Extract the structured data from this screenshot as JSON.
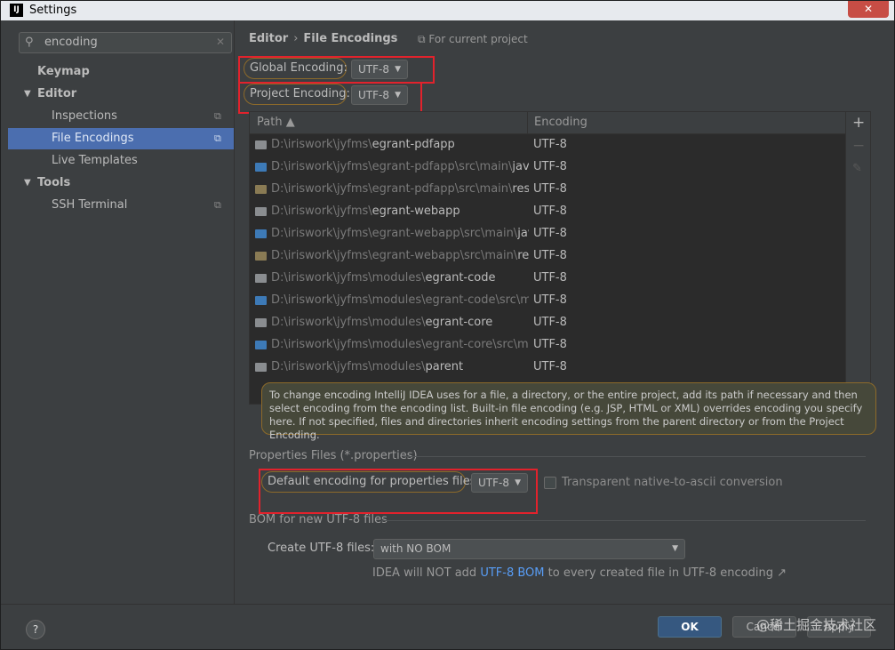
{
  "window": {
    "title": "Settings",
    "app_icon": "IJ",
    "close_glyph": "✕"
  },
  "sidebar": {
    "search_value": "encoding",
    "items": [
      {
        "label": "Keymap"
      },
      {
        "label": "Editor"
      },
      {
        "label": "Inspections"
      },
      {
        "label": "File Encodings"
      },
      {
        "label": "Live Templates"
      },
      {
        "label": "Tools"
      },
      {
        "label": "SSH Terminal"
      }
    ]
  },
  "header": {
    "crumb_parent": "Editor",
    "crumb_sep": "›",
    "crumb_current": "File Encodings",
    "scope": "For current project"
  },
  "global_encoding": {
    "label": "Global Encoding:",
    "value": "UTF-8"
  },
  "project_encoding": {
    "label": "Project Encoding:",
    "value": "UTF-8"
  },
  "table": {
    "col_path": "Path",
    "col_encoding": "Encoding",
    "rows": [
      {
        "dim": "D:\\iriswork\\jyfms\\",
        "name": "egrant-pdfapp",
        "enc": "UTF-8",
        "icon": "module-folder"
      },
      {
        "dim": "D:\\iriswork\\jyfms\\egrant-pdfapp\\src\\main\\",
        "name": "java",
        "enc": "UTF-8",
        "icon": "source-folder"
      },
      {
        "dim": "D:\\iriswork\\jyfms\\egrant-pdfapp\\src\\main\\",
        "name": "resour",
        "enc": "UTF-8",
        "icon": "resource-folder"
      },
      {
        "dim": "D:\\iriswork\\jyfms\\",
        "name": "egrant-webapp",
        "enc": "UTF-8",
        "icon": "module-folder"
      },
      {
        "dim": "D:\\iriswork\\jyfms\\egrant-webapp\\src\\main\\",
        "name": "java",
        "enc": "UTF-8",
        "icon": "source-folder"
      },
      {
        "dim": "D:\\iriswork\\jyfms\\egrant-webapp\\src\\main\\",
        "name": "resour",
        "enc": "UTF-8",
        "icon": "resource-folder"
      },
      {
        "dim": "D:\\iriswork\\jyfms\\modules\\",
        "name": "egrant-code",
        "enc": "UTF-8",
        "icon": "module-folder"
      },
      {
        "dim": "D:\\iriswork\\jyfms\\modules\\egrant-code\\src\\main\\",
        "name": "",
        "enc": "UTF-8",
        "icon": "source-folder"
      },
      {
        "dim": "D:\\iriswork\\jyfms\\modules\\",
        "name": "egrant-core",
        "enc": "UTF-8",
        "icon": "module-folder"
      },
      {
        "dim": "D:\\iriswork\\jyfms\\modules\\egrant-core\\src\\main\\",
        "name": "",
        "enc": "UTF-8",
        "icon": "source-folder"
      },
      {
        "dim": "D:\\iriswork\\jyfms\\modules\\",
        "name": "parent",
        "enc": "UTF-8",
        "icon": "module-folder"
      }
    ]
  },
  "info_text": "To change encoding IntelliJ IDEA uses for a file, a directory, or the entire project, add its path if necessary and then select encoding from the encoding list. Built-in file encoding (e.g. JSP, HTML or XML) overrides encoding you specify here. If not specified, files and directories inherit encoding settings from the parent directory or from the Project Encoding.",
  "properties": {
    "section_title": "Properties Files (*.properties)",
    "default_label": "Default encoding for properties files:",
    "default_value": "UTF-8",
    "transparent_label": "Transparent native-to-ascii conversion"
  },
  "bom": {
    "section_title": "BOM for new UTF-8 files",
    "create_label": "Create UTF-8 files:",
    "create_value": "with NO BOM",
    "note_prefix": "IDEA will NOT add ",
    "note_link": "UTF-8 BOM",
    "note_suffix": " to every created file in UTF-8 encoding ↗"
  },
  "footer": {
    "help": "?",
    "ok": "OK",
    "cancel": "Cancel",
    "apply": "Apply",
    "watermark": "@稀土掘金技术社区"
  },
  "colors": {
    "selection": "#4b6eaf",
    "highlight_box": "#e2222c",
    "link": "#589df6",
    "ok_button": "#365880"
  }
}
